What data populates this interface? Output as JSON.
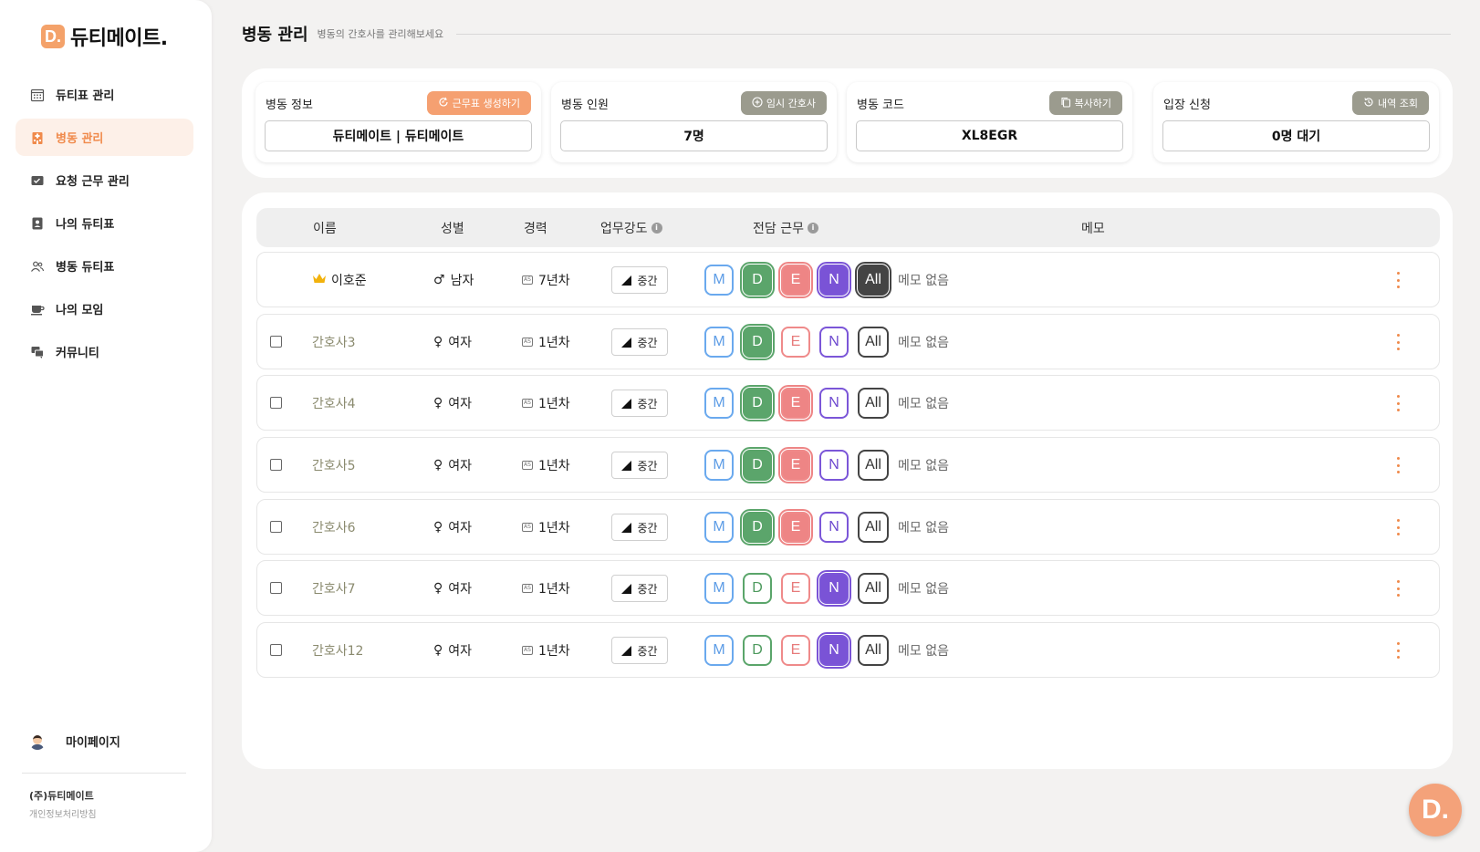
{
  "app": {
    "logo_letter": "D.",
    "name": "듀티메이트."
  },
  "sidebar": {
    "items": [
      {
        "label": "듀티표 관리",
        "icon": "calendar-icon",
        "active": false
      },
      {
        "label": "병동 관리",
        "icon": "hospital-icon",
        "active": true
      },
      {
        "label": "요청 근무 관리",
        "icon": "request-icon",
        "active": false
      },
      {
        "label": "나의 듀티표",
        "icon": "profile-card-icon",
        "active": false
      },
      {
        "label": "병동 듀티표",
        "icon": "people-icon",
        "active": false
      },
      {
        "label": "나의 모임",
        "icon": "coffee-icon",
        "active": false
      },
      {
        "label": "커뮤니티",
        "icon": "chat-icon",
        "active": false
      }
    ],
    "mypage_label": "마이페이지",
    "company": "(주)듀티메이트",
    "privacy": "개인정보처리방침"
  },
  "header": {
    "title": "병동 관리",
    "subtitle": "병동의 간호사를 관리해보세요"
  },
  "cards": {
    "ward_info": {
      "label": "병동 정보",
      "button": "근무표 생성하기",
      "value": "듀티메이트 | 듀티메이트"
    },
    "ward_staff": {
      "label": "병동 인원",
      "button": "임시 간호사",
      "value": "7명"
    },
    "ward_code": {
      "label": "병동 코드",
      "button": "복사하기",
      "value": "XL8EGR"
    },
    "join_request": {
      "label": "입장 신청",
      "button": "내역 조회",
      "value": "0명 대기"
    }
  },
  "table": {
    "columns": {
      "name": "이름",
      "gender": "성별",
      "career": "경력",
      "intensity": "업무강도",
      "shift": "전담 근무",
      "memo": "메모"
    },
    "info_mark": "i",
    "career_icon_text": "AS",
    "shift_labels": {
      "M": "M",
      "D": "D",
      "E": "E",
      "N": "N",
      "All": "All"
    },
    "rows": [
      {
        "name": "이호준",
        "head": true,
        "gender": "남자",
        "gender_symbol": "♂",
        "career": "7년차",
        "intensity": "중간",
        "shifts_on": [
          "D",
          "E",
          "N",
          "All"
        ],
        "memo": "메모 없음"
      },
      {
        "name": "간호사3",
        "head": false,
        "gender": "여자",
        "gender_symbol": "♀",
        "career": "1년차",
        "intensity": "중간",
        "shifts_on": [
          "D"
        ],
        "memo": "메모 없음"
      },
      {
        "name": "간호사4",
        "head": false,
        "gender": "여자",
        "gender_symbol": "♀",
        "career": "1년차",
        "intensity": "중간",
        "shifts_on": [
          "D",
          "E"
        ],
        "memo": "메모 없음"
      },
      {
        "name": "간호사5",
        "head": false,
        "gender": "여자",
        "gender_symbol": "♀",
        "career": "1년차",
        "intensity": "중간",
        "shifts_on": [
          "D",
          "E"
        ],
        "memo": "메모 없음"
      },
      {
        "name": "간호사6",
        "head": false,
        "gender": "여자",
        "gender_symbol": "♀",
        "career": "1년차",
        "intensity": "중간",
        "shifts_on": [
          "D",
          "E"
        ],
        "memo": "메모 없음"
      },
      {
        "name": "간호사7",
        "head": false,
        "gender": "여자",
        "gender_symbol": "♀",
        "career": "1년차",
        "intensity": "중간",
        "shifts_on": [
          "N"
        ],
        "memo": "메모 없음"
      },
      {
        "name": "간호사12",
        "head": false,
        "gender": "여자",
        "gender_symbol": "♀",
        "career": "1년차",
        "intensity": "중간",
        "shifts_on": [
          "N"
        ],
        "memo": "메모 없음"
      }
    ]
  },
  "fab_label": "D."
}
